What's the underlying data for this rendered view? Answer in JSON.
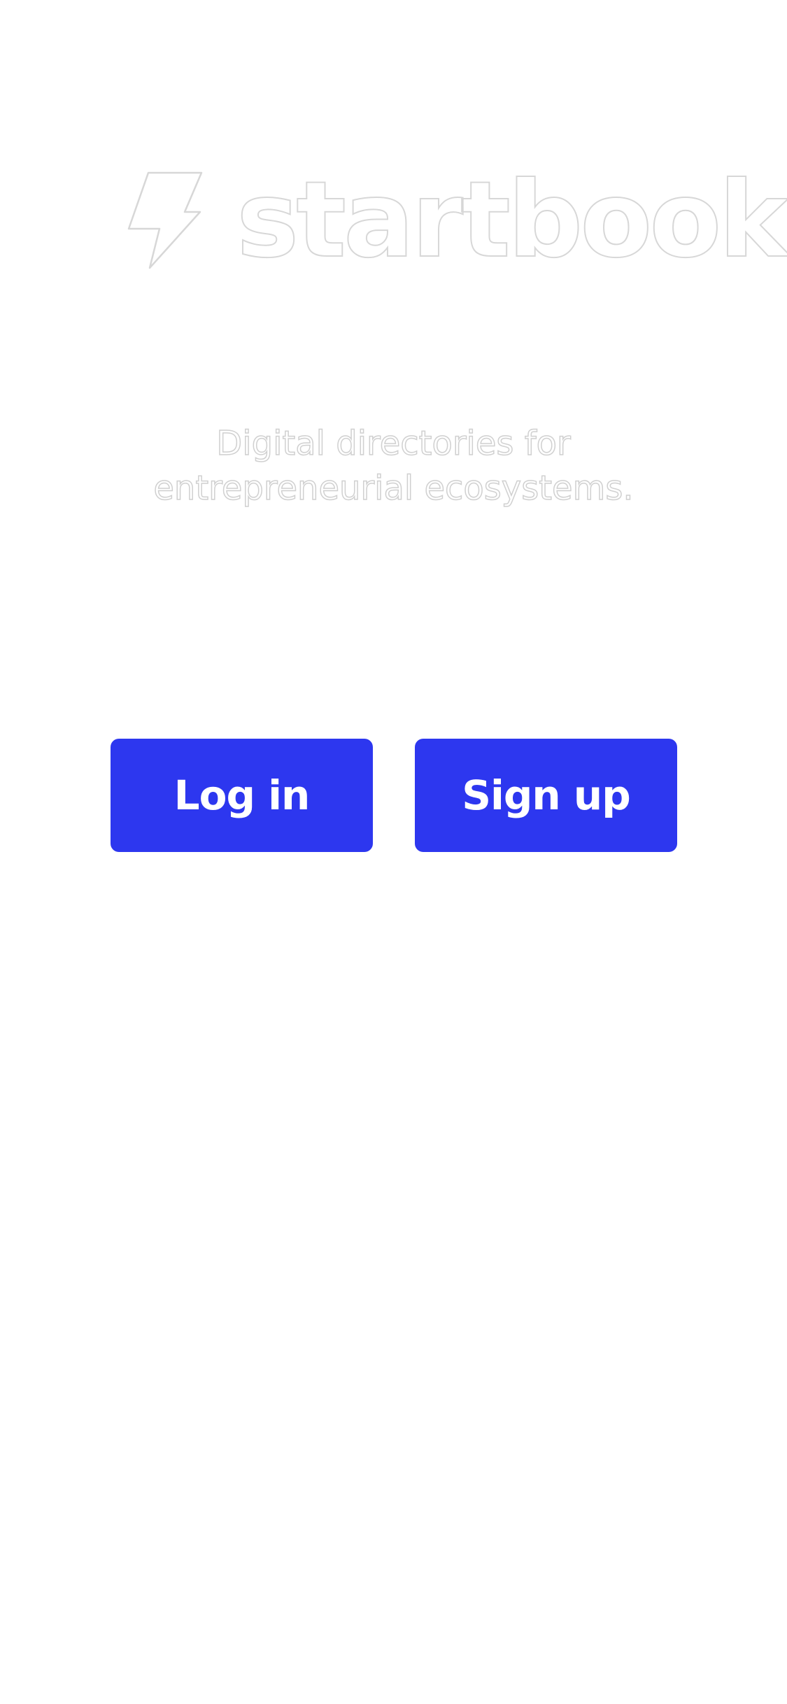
{
  "app": {
    "name": "startbook",
    "logo_icon": "lightning-bolt-icon"
  },
  "welcome": {
    "tagline_line1": "Digital directories for",
    "tagline_line2": "entrepreneurial ecosystems."
  },
  "actions": {
    "login_label": "Log in",
    "signup_label": "Sign up"
  },
  "colors": {
    "background": "#ffffff",
    "accent": "#2d37ef",
    "button_text": "#ffffff",
    "logo_outline": "#d7d7d7"
  }
}
